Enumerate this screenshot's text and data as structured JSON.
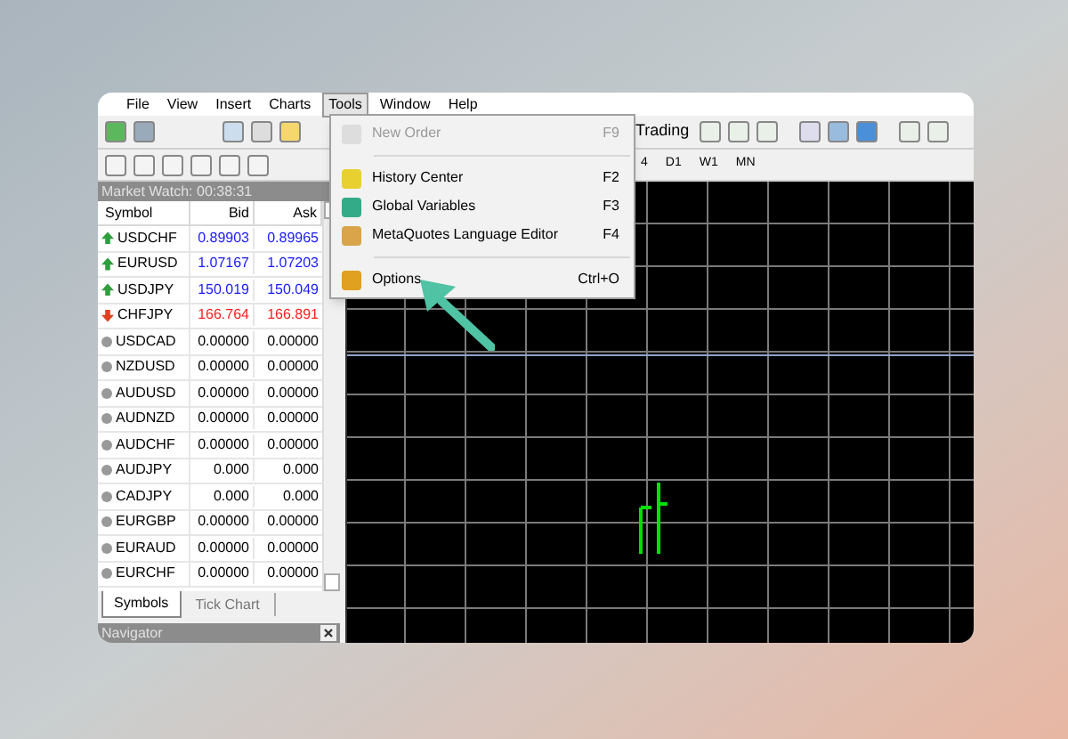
{
  "menu_bar": [
    {
      "label": "File",
      "selected": false
    },
    {
      "label": "View",
      "selected": false
    },
    {
      "label": "Insert",
      "selected": false
    },
    {
      "label": "Charts",
      "selected": false
    },
    {
      "label": "Tools",
      "selected": true
    },
    {
      "label": "Window",
      "selected": false
    },
    {
      "label": "Help",
      "selected": false
    }
  ],
  "toolbar": {
    "trading_button": "Trading",
    "timeframes": [
      "4",
      "D1",
      "W1",
      "MN"
    ]
  },
  "tools_menu": [
    {
      "kind": "item",
      "label": "New Order",
      "shortcut": "F9",
      "disabled": true
    },
    {
      "kind": "separator"
    },
    {
      "kind": "item",
      "label": "History Center",
      "shortcut": "F2",
      "disabled": false
    },
    {
      "kind": "item",
      "label": "Global Variables",
      "shortcut": "F3",
      "disabled": false
    },
    {
      "kind": "item",
      "label": "MetaQuotes Language Editor",
      "shortcut": "F4",
      "disabled": false
    },
    {
      "kind": "separator"
    },
    {
      "kind": "item",
      "label": "Options",
      "shortcut": "Ctrl+O",
      "disabled": false
    }
  ],
  "market_watch": {
    "title": "Market Watch: 00:38:31",
    "columns": [
      "Symbol",
      "Bid",
      "Ask"
    ],
    "rows": [
      {
        "kind": "up",
        "symbol": "USDCHF",
        "bid": "0.89903",
        "ask": "0.89965"
      },
      {
        "kind": "up",
        "symbol": "EURUSD",
        "bid": "1.07167",
        "ask": "1.07203"
      },
      {
        "kind": "up",
        "symbol": "USDJPY",
        "bid": "150.019",
        "ask": "150.049"
      },
      {
        "kind": "down",
        "symbol": "CHFJPY",
        "bid": "166.764",
        "ask": "166.891"
      },
      {
        "kind": "flat",
        "symbol": "USDCAD",
        "bid": "0.00000",
        "ask": "0.00000"
      },
      {
        "kind": "flat",
        "symbol": "NZDUSD",
        "bid": "0.00000",
        "ask": "0.00000"
      },
      {
        "kind": "flat",
        "symbol": "AUDUSD",
        "bid": "0.00000",
        "ask": "0.00000"
      },
      {
        "kind": "flat",
        "symbol": "AUDNZD",
        "bid": "0.00000",
        "ask": "0.00000"
      },
      {
        "kind": "flat",
        "symbol": "AUDCHF",
        "bid": "0.00000",
        "ask": "0.00000"
      },
      {
        "kind": "flat",
        "symbol": "AUDJPY",
        "bid": "0.000",
        "ask": "0.000"
      },
      {
        "kind": "flat",
        "symbol": "CADJPY",
        "bid": "0.000",
        "ask": "0.000"
      },
      {
        "kind": "flat",
        "symbol": "EURGBP",
        "bid": "0.00000",
        "ask": "0.00000"
      },
      {
        "kind": "flat",
        "symbol": "EURAUD",
        "bid": "0.00000",
        "ask": "0.00000"
      },
      {
        "kind": "flat",
        "symbol": "EURCHF",
        "bid": "0.00000",
        "ask": "0.00000"
      }
    ],
    "tabs": [
      {
        "label": "Symbols",
        "selected": true
      },
      {
        "label": "Tick Chart",
        "selected": false
      }
    ]
  },
  "navigator": {
    "title": "Navigator"
  }
}
